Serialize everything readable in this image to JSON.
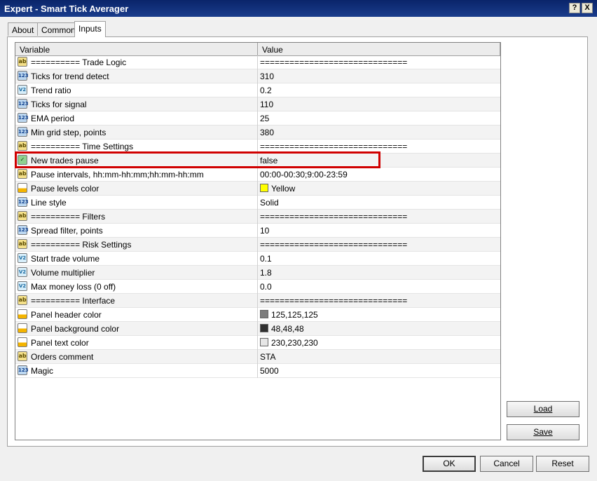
{
  "window": {
    "title": "Expert - Smart Tick Averager",
    "help_btn": "?",
    "close_btn": "X"
  },
  "tabs": [
    "About",
    "Common",
    "Inputs"
  ],
  "columns": {
    "variable": "Variable",
    "value": "Value"
  },
  "rows": [
    {
      "icon": "ab",
      "name": "========== Trade Logic",
      "value": "=============================="
    },
    {
      "icon": "123",
      "name": "Ticks for trend detect",
      "value": "310"
    },
    {
      "icon": "V2",
      "name": "Trend ratio",
      "value": "0.2"
    },
    {
      "icon": "123",
      "name": "Ticks for signal",
      "value": "110"
    },
    {
      "icon": "123",
      "name": "EMA period",
      "value": "25"
    },
    {
      "icon": "123",
      "name": "Min grid step, points",
      "value": "380"
    },
    {
      "icon": "ab",
      "name": "========== Time Settings",
      "value": "=============================="
    },
    {
      "icon": "bool",
      "name": "New trades pause",
      "value": "false"
    },
    {
      "icon": "ab",
      "name": "Pause intervals, hh:mm-hh:mm;hh:mm-hh:mm",
      "value": "00:00-00:30;9:00-23:59"
    },
    {
      "icon": "color",
      "name": "Pause levels color",
      "value": "Yellow",
      "swatch": "#ffff00"
    },
    {
      "icon": "line",
      "name": "Line style",
      "value": "Solid"
    },
    {
      "icon": "ab",
      "name": "========== Filters",
      "value": "=============================="
    },
    {
      "icon": "123",
      "name": "Spread filter, points",
      "value": "10"
    },
    {
      "icon": "ab",
      "name": "========== Risk Settings",
      "value": "=============================="
    },
    {
      "icon": "V2",
      "name": "Start trade volume",
      "value": "0.1"
    },
    {
      "icon": "V2",
      "name": "Volume multiplier",
      "value": "1.8"
    },
    {
      "icon": "V2",
      "name": "Max money loss (0 off)",
      "value": "0.0"
    },
    {
      "icon": "ab",
      "name": "========== Interface",
      "value": "=============================="
    },
    {
      "icon": "color",
      "name": "Panel header color",
      "value": "125,125,125",
      "swatch": "#7d7d7d"
    },
    {
      "icon": "color",
      "name": "Panel background color",
      "value": "48,48,48",
      "swatch": "#303030"
    },
    {
      "icon": "color",
      "name": "Panel text color",
      "value": "230,230,230",
      "swatch": "#e6e6e6"
    },
    {
      "icon": "ab",
      "name": "Orders comment",
      "value": "STA"
    },
    {
      "icon": "123",
      "name": "Magic",
      "value": "5000"
    }
  ],
  "buttons": {
    "load": "Load",
    "save": "Save",
    "ok": "OK",
    "cancel": "Cancel",
    "reset": "Reset"
  }
}
